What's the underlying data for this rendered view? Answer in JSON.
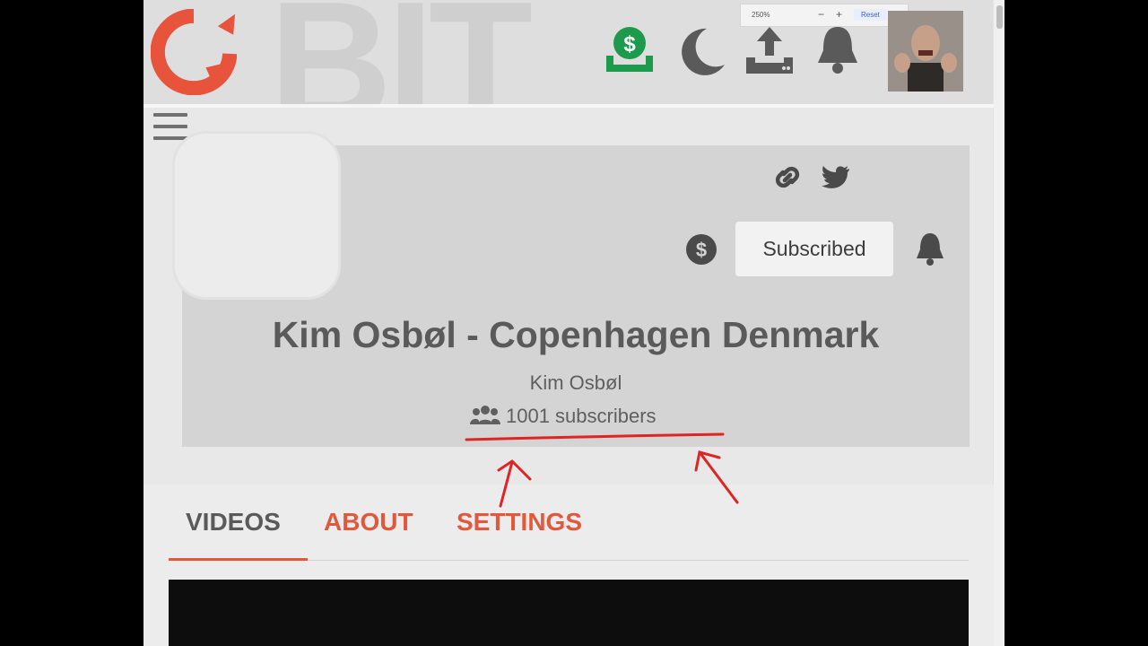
{
  "browser": {
    "zoom_level": "250%",
    "zoom_out": "−",
    "zoom_in": "+",
    "reset_label": "Reset"
  },
  "header": {
    "icons": [
      "logo",
      "earnings-icon",
      "dark-mode-icon",
      "upload-icon",
      "notifications-icon",
      "avatar"
    ],
    "colors": {
      "brand": "#e8533b",
      "earnings": "#1d9a4c",
      "icon_dark": "#5a5a5a"
    }
  },
  "channel": {
    "title": "Kim Osbøl - Copenhagen Denmark",
    "owner": "Kim Osbøl",
    "subscribers": "1001 subscribers",
    "subscribe_label": "Subscribed",
    "icons": [
      "link-icon",
      "twitter-icon",
      "tip-dollar-icon",
      "bell-icon",
      "users-icon"
    ]
  },
  "tabs": [
    {
      "label": "VIDEOS",
      "active": true
    },
    {
      "label": "ABOUT",
      "active": false
    },
    {
      "label": "SETTINGS",
      "active": false
    }
  ],
  "annotation": {
    "color": "#e02424",
    "marks": [
      "underline",
      "arrow-left",
      "arrow-right"
    ]
  }
}
